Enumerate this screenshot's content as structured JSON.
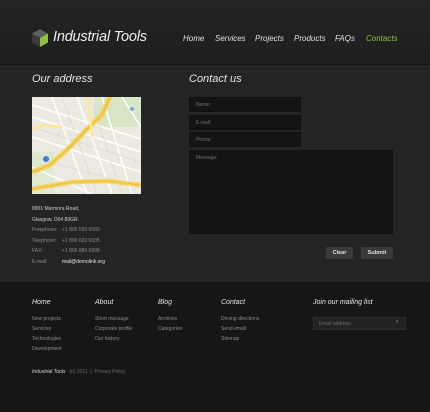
{
  "header": {
    "logo_text": "Industrial Tools",
    "nav": [
      {
        "label": "Home",
        "active": false
      },
      {
        "label": "Services",
        "active": false
      },
      {
        "label": "Projects",
        "active": false
      },
      {
        "label": "Products",
        "active": false
      },
      {
        "label": "FAQs",
        "active": false
      },
      {
        "label": "Contacts",
        "active": true
      }
    ]
  },
  "address": {
    "title": "Our address",
    "line1": "8901 Marmora Road,",
    "line2": "Glasgow, D04 89GR.",
    "freephone_label": "Freephone:",
    "freephone": "+1 800 559 6580",
    "telephone_label": "Telephone:",
    "telephone": "+1 800 603 6035",
    "fax_label": "FAX:",
    "fax": "+1 800 889 9898",
    "email_label": "E-mail:",
    "email": "mail@demolink.org"
  },
  "contact": {
    "title": "Contact us",
    "name_placeholder": "Name:",
    "email_placeholder": "E-mail:",
    "phone_placeholder": "Phone:",
    "message_placeholder": "Message:",
    "clear_label": "Clear",
    "submit_label": "Submit"
  },
  "footer": {
    "columns": [
      {
        "title": "Home",
        "links": [
          "New projects",
          "Services",
          "Technologies",
          "Development"
        ]
      },
      {
        "title": "About",
        "links": [
          "Short message",
          "Corporate profile",
          "Our history"
        ]
      },
      {
        "title": "Blog",
        "links": [
          "Archives",
          "Categories"
        ]
      },
      {
        "title": "Contact",
        "links": [
          "Driving directions",
          "Send email",
          "Sitemap"
        ]
      }
    ],
    "newsletter_title": "Join our mailing list",
    "newsletter_placeholder": "Email address",
    "newsletter_arrow": "›",
    "brand": "Industrial Tools",
    "copyright": "(c) 2011",
    "privacy": "Privacy Policy"
  },
  "colors": {
    "accent": "#8cc63e",
    "background": "#242424",
    "footer_bg": "#161616"
  }
}
